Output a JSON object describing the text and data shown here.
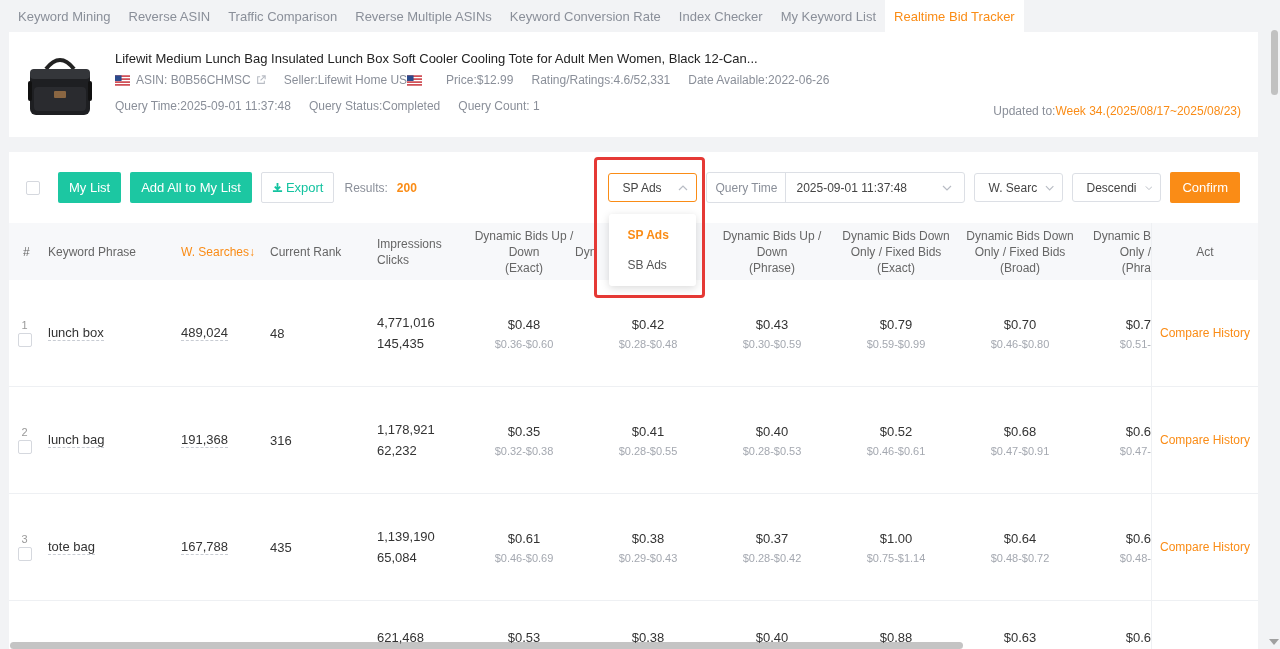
{
  "tabs": [
    {
      "label": "Keyword Mining",
      "selected": false
    },
    {
      "label": "Reverse ASIN",
      "selected": false
    },
    {
      "label": "Traffic Comparison",
      "selected": false
    },
    {
      "label": "Reverse Multiple ASINs",
      "selected": false
    },
    {
      "label": "Keyword Conversion Rate",
      "selected": false
    },
    {
      "label": "Index Checker",
      "selected": false
    },
    {
      "label": "My Keyword List",
      "selected": false
    },
    {
      "label": "Realtime Bid Tracker",
      "selected": true
    }
  ],
  "product": {
    "title": "Lifewit Medium Lunch Bag Insulated Lunch Box Soft Cooler Cooling Tote for Adult Men Women, Black 12-Can...",
    "asin": "ASIN: B0B56CHMSC",
    "seller": "Seller:Lifewit Home US",
    "price": "Price:$12.99",
    "rating": "Rating/Ratings:4.6/52,331",
    "date_available": "Date Available:2022-06-26",
    "query_time": "Query Time:2025-09-01 11:37:48",
    "query_status": "Query Status:Completed",
    "query_count": "Query Count: 1",
    "updated_label": "Updated to:",
    "updated_week": "Week 34.(2025/08/17~2025/08/23)"
  },
  "toolbar": {
    "select_all_checked": false,
    "buttons": [
      {
        "label": "My List",
        "kind": "primary"
      },
      {
        "label": "Add All to My List",
        "kind": "primary"
      },
      {
        "label": "Export",
        "kind": "outline"
      }
    ],
    "results_label": "Results:",
    "results_count": "200",
    "ad_type": {
      "value": "SP Ads",
      "expanded": true,
      "options": [
        {
          "label": "SP Ads",
          "selected": true
        },
        {
          "label": "SB Ads",
          "selected": false
        }
      ]
    },
    "query_time_label": "Query Time",
    "query_time_value": "2025-09-01 11:37:48",
    "sort_field": "W. Searc",
    "sort_order": "Descendi",
    "confirm": "Confirm"
  },
  "table": {
    "columns": [
      {
        "label": "#",
        "sorted": false
      },
      {
        "label": "Keyword Phrase",
        "sorted": false
      },
      {
        "label": "W. Searches↓",
        "sorted": true
      },
      {
        "label": "Current Rank",
        "sorted": false
      },
      {
        "label": "Impressions\nClicks",
        "sorted": false
      },
      {
        "label": "Dynamic Bids Up /\nDown\n(Exact)",
        "sorted": false
      },
      {
        "label": "Dyn",
        "sorted": false
      },
      {
        "label": "Dynamic Bids Up /\nDown\n(Phrase)",
        "sorted": false
      },
      {
        "label": "Dynamic Bids Down\nOnly / Fixed Bids\n(Exact)",
        "sorted": false
      },
      {
        "label": "Dynamic Bids Down\nOnly / Fixed Bids\n(Broad)",
        "sorted": false
      },
      {
        "label": "Dynamic B\nOnly /\n(Phra",
        "sorted": false
      },
      {
        "label": "Act",
        "sorted": false
      }
    ],
    "rows": [
      {
        "index": "1",
        "checked": false,
        "keyword": "lunch box",
        "searches": "489,024",
        "rank": "48",
        "impressions": "4,771,016",
        "clicks": "145,435",
        "bids": [
          {
            "bid": "$0.48",
            "range": "$0.36-$0.60"
          },
          {
            "bid": "$0.42",
            "range": "$0.28-$0.48"
          },
          {
            "bid": "$0.43",
            "range": "$0.30-$0.59"
          },
          {
            "bid": "$0.79",
            "range": "$0.59-$0.99"
          },
          {
            "bid": "$0.70",
            "range": "$0.46-$0.80"
          },
          {
            "bid": "$0.7",
            "range": "$0.51-"
          }
        ],
        "action": "Compare History"
      },
      {
        "index": "2",
        "checked": false,
        "keyword": "lunch bag",
        "searches": "191,368",
        "rank": "316",
        "impressions": "1,178,921",
        "clicks": "62,232",
        "bids": [
          {
            "bid": "$0.35",
            "range": "$0.32-$0.38"
          },
          {
            "bid": "$0.41",
            "range": "$0.28-$0.55"
          },
          {
            "bid": "$0.40",
            "range": "$0.28-$0.53"
          },
          {
            "bid": "$0.52",
            "range": "$0.46-$0.61"
          },
          {
            "bid": "$0.68",
            "range": "$0.47-$0.91"
          },
          {
            "bid": "$0.6",
            "range": "$0.47-"
          }
        ],
        "action": "Compare History"
      },
      {
        "index": "3",
        "checked": false,
        "keyword": "tote bag",
        "searches": "167,788",
        "rank": "435",
        "impressions": "1,139,190",
        "clicks": "65,084",
        "bids": [
          {
            "bid": "$0.61",
            "range": "$0.46-$0.69"
          },
          {
            "bid": "$0.38",
            "range": "$0.29-$0.43"
          },
          {
            "bid": "$0.37",
            "range": "$0.28-$0.42"
          },
          {
            "bid": "$1.00",
            "range": "$0.75-$1.14"
          },
          {
            "bid": "$0.64",
            "range": "$0.48-$0.72"
          },
          {
            "bid": "$0.6",
            "range": "$0.48-"
          }
        ],
        "action": "Compare History"
      },
      {
        "impressions": "621,468",
        "bids": [
          {
            "bid": "$0.53"
          },
          {
            "bid": "$0.38"
          },
          {
            "bid": "$0.40"
          },
          {
            "bid": "$0.88"
          },
          {
            "bid": "$0.63"
          },
          {
            "bid": "$0.6"
          }
        ]
      }
    ]
  }
}
